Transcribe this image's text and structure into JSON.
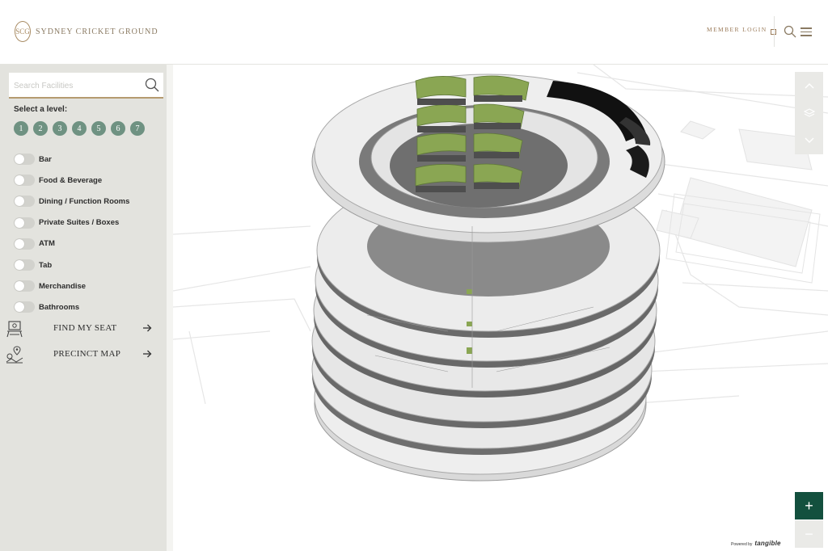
{
  "header": {
    "logo_mark": "SCG",
    "logo_text": "SYDNEY CRICKET GROUND",
    "member_login": "MEMBER LOGIN"
  },
  "sidebar": {
    "search_placeholder": "Search Facilities",
    "level_label": "Select a level:",
    "levels": [
      "1",
      "2",
      "3",
      "4",
      "5",
      "6",
      "7"
    ],
    "facilities": [
      "Bar",
      "Food & Beverage",
      "Dining / Function Rooms",
      "Private Suites / Boxes",
      "ATM",
      "Tab",
      "Merchandise",
      "Bathrooms"
    ],
    "find_my_seat": "FIND MY SEAT",
    "precinct_map": "PRECINCT MAP"
  },
  "map": {
    "zoom_in": "+",
    "zoom_out": "−",
    "powered_by": "Powered by",
    "brand": "tangible"
  },
  "colors": {
    "accent_gold": "#b59a6f",
    "level_green": "#6f9282",
    "zoom_green": "#13503e",
    "sidebar_bg": "#e3e3de",
    "turf_green": "#8aa653"
  },
  "icons": [
    "logo-icon",
    "external-link-icon",
    "search-icon",
    "menu-icon",
    "seat-icon",
    "map-pin-icon",
    "arrow-right-icon",
    "chevron-up-icon",
    "layers-icon",
    "chevron-down-icon"
  ]
}
